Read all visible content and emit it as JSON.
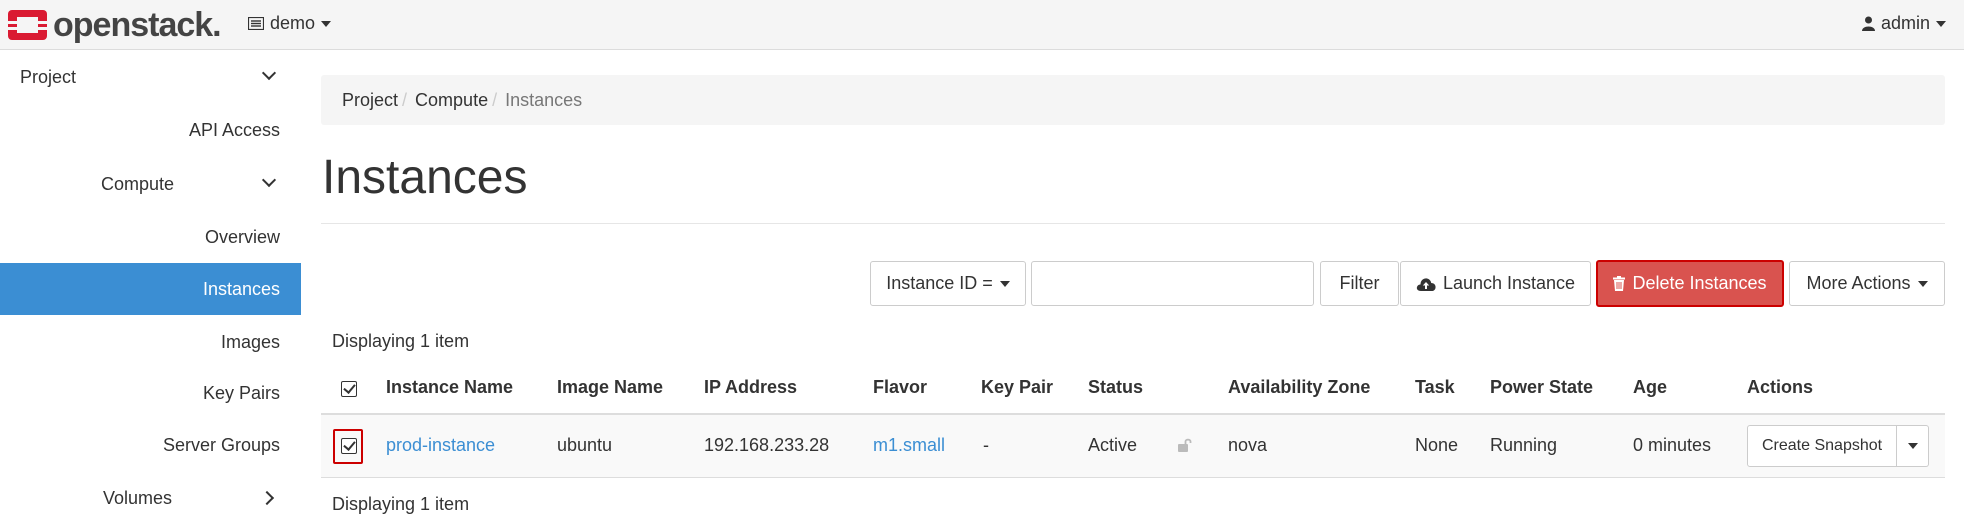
{
  "header": {
    "brand": "openstack.",
    "project": "demo",
    "user": "admin",
    "brand_color": "#da1a32"
  },
  "sidebar": {
    "items": [
      {
        "label": "Project",
        "expanded": true
      },
      {
        "label": "API Access"
      },
      {
        "label": "Compute",
        "expanded": true
      },
      {
        "label": "Overview"
      },
      {
        "label": "Instances",
        "active": true
      },
      {
        "label": "Images"
      },
      {
        "label": "Key Pairs"
      },
      {
        "label": "Server Groups"
      },
      {
        "label": "Volumes",
        "expanded": false
      }
    ],
    "active_color": "#3b8ed3"
  },
  "breadcrumb": {
    "items": [
      "Project",
      "Compute",
      "Instances"
    ]
  },
  "page": {
    "title": "Instances"
  },
  "toolbar": {
    "filter_select": "Instance ID =",
    "filter_value": "",
    "filter_button": "Filter",
    "launch_button": "Launch Instance",
    "delete_button": "Delete Instances",
    "more_actions": "More Actions"
  },
  "table": {
    "count_top": "Displaying 1 item",
    "count_bottom": "Displaying 1 item",
    "columns": [
      "Instance Name",
      "Image Name",
      "IP Address",
      "Flavor",
      "Key Pair",
      "Status",
      "Availability Zone",
      "Task",
      "Power State",
      "Age",
      "Actions"
    ],
    "rows": [
      {
        "selected": true,
        "instance_name": "prod-instance",
        "image_name": "ubuntu",
        "ip_address": "192.168.233.28",
        "flavor": "m1.small",
        "key_pair": "-",
        "status": "Active",
        "availability_zone": "nova",
        "task": "None",
        "power_state": "Running",
        "age": "0 minutes",
        "action": "Create Snapshot"
      }
    ]
  }
}
